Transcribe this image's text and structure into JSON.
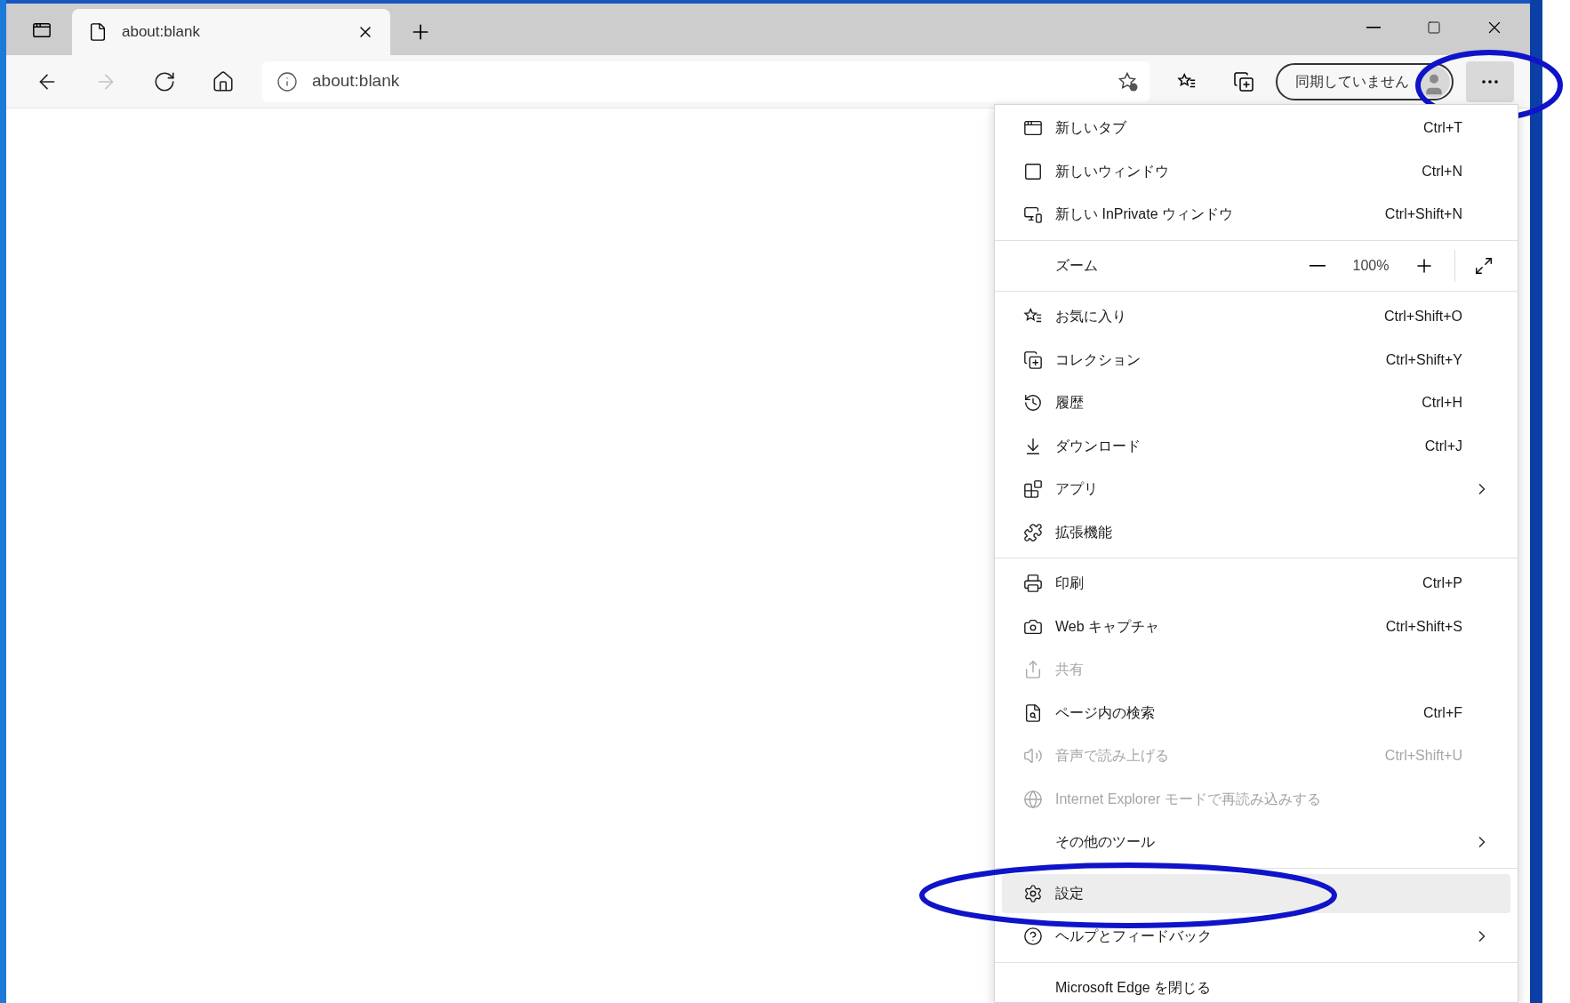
{
  "tabs": [
    {
      "title": "about:blank",
      "selected": true
    }
  ],
  "nav_buttons": [
    {
      "kind": "back",
      "disabled": false
    },
    {
      "kind": "forward",
      "disabled": true
    },
    {
      "kind": "refresh",
      "disabled": false
    },
    {
      "kind": "home",
      "disabled": false
    }
  ],
  "address_bar": {
    "url": "about:blank"
  },
  "profile_button": {
    "label": "同期していません"
  },
  "more_button": {
    "circled": true
  },
  "menu": {
    "sections": [
      [
        {
          "kind": "item",
          "label": "新しいタブ",
          "shortcut": "Ctrl+T",
          "disabled": false,
          "submenu": false,
          "selected": false,
          "circled": false
        },
        {
          "kind": "item",
          "label": "新しいウィンドウ",
          "shortcut": "Ctrl+N",
          "disabled": false,
          "submenu": false,
          "selected": false,
          "circled": false
        },
        {
          "kind": "item",
          "label": "新しい InPrivate ウィンドウ",
          "shortcut": "Ctrl+Shift+N",
          "disabled": false,
          "submenu": false,
          "selected": false,
          "circled": false
        }
      ],
      [
        {
          "kind": "zoom",
          "label": "ズーム",
          "value": "100%"
        }
      ],
      [
        {
          "kind": "item",
          "label": "お気に入り",
          "shortcut": "Ctrl+Shift+O",
          "disabled": false,
          "submenu": false,
          "selected": false,
          "circled": false
        },
        {
          "kind": "item",
          "label": "コレクション",
          "shortcut": "Ctrl+Shift+Y",
          "disabled": false,
          "submenu": false,
          "selected": false,
          "circled": false
        },
        {
          "kind": "item",
          "label": "履歴",
          "shortcut": "Ctrl+H",
          "disabled": false,
          "submenu": false,
          "selected": false,
          "circled": false
        },
        {
          "kind": "item",
          "label": "ダウンロード",
          "shortcut": "Ctrl+J",
          "disabled": false,
          "submenu": false,
          "selected": false,
          "circled": false
        },
        {
          "kind": "item",
          "label": "アプリ",
          "disabled": false,
          "submenu": true,
          "selected": false,
          "circled": false
        },
        {
          "kind": "item",
          "label": "拡張機能",
          "disabled": false,
          "submenu": false,
          "selected": false,
          "circled": false
        }
      ],
      [
        {
          "kind": "item",
          "label": "印刷",
          "shortcut": "Ctrl+P",
          "disabled": false,
          "submenu": false,
          "selected": false,
          "circled": false
        },
        {
          "kind": "item",
          "label": "Web キャプチャ",
          "shortcut": "Ctrl+Shift+S",
          "disabled": false,
          "submenu": false,
          "selected": false,
          "circled": false
        },
        {
          "kind": "item",
          "label": "共有",
          "disabled": true,
          "submenu": false,
          "selected": false,
          "circled": false
        },
        {
          "kind": "item",
          "label": "ページ内の検索",
          "shortcut": "Ctrl+F",
          "disabled": false,
          "submenu": false,
          "selected": false,
          "circled": false
        },
        {
          "kind": "item",
          "label": "音声で読み上げる",
          "shortcut": "Ctrl+Shift+U",
          "disabled": true,
          "submenu": false,
          "selected": false,
          "circled": false
        },
        {
          "kind": "item",
          "label": "Internet Explorer モードで再読み込みする",
          "disabled": true,
          "submenu": false,
          "selected": false,
          "circled": false
        },
        {
          "kind": "item",
          "label": "その他のツール",
          "disabled": false,
          "submenu": true,
          "selected": false,
          "circled": false
        }
      ],
      [
        {
          "kind": "item",
          "label": "設定",
          "disabled": false,
          "submenu": false,
          "selected": true,
          "circled": true
        },
        {
          "kind": "item",
          "label": "ヘルプとフィードバック",
          "disabled": false,
          "submenu": true,
          "selected": false,
          "circled": false
        }
      ],
      [
        {
          "kind": "item",
          "label": "Microsoft Edge を閉じる",
          "disabled": false,
          "submenu": false,
          "selected": false,
          "circled": false
        }
      ]
    ]
  }
}
